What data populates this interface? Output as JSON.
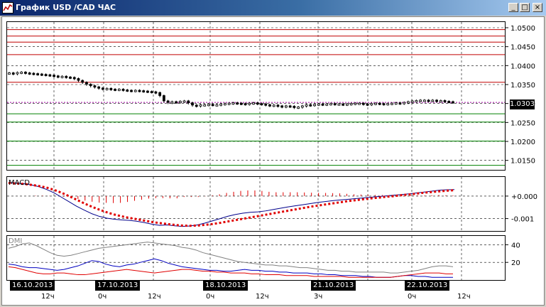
{
  "window": {
    "title": "График USD /CAD  ЧАС",
    "icon": "chart-window-icon",
    "controls": {
      "minimize": "_",
      "maximize": "□",
      "close": "×"
    }
  },
  "colors": {
    "titlebar": "#0a246a",
    "candle": "#000000",
    "resistance": "#c00000",
    "support": "#008000",
    "current_price_line": "#a000a0",
    "macd_line": "#00008b",
    "macd_signal": "#e00000",
    "dmi_adx": "#808080",
    "dmi_plus": "#0000c0",
    "dmi_minus": "#e00000"
  },
  "price_panel": {
    "ticks": [
      "1.0500",
      "1.0450",
      "1.0400",
      "1.0350",
      "1.0300",
      "1.0250",
      "1.0200",
      "1.0150"
    ],
    "current_price": "1.0303",
    "resistance_levels": [
      1.0495,
      1.0478,
      1.0462,
      1.0429,
      1.0356
    ],
    "support_levels": [
      1.0273,
      1.0251,
      1.0201,
      1.0137
    ]
  },
  "macd_panel": {
    "label": "MACD",
    "ticks": [
      "+0.000",
      "-0.001"
    ]
  },
  "dmi_panel": {
    "label": "DMI",
    "ticks": [
      "40",
      "20"
    ]
  },
  "time_axis": {
    "dates": [
      "16.10.2013",
      "17.10.2013",
      "18.10.2013",
      "21.10.2013",
      "22.10.2013"
    ],
    "hours": [
      "12ч",
      "0ч",
      "12ч",
      "0ч",
      "12ч",
      "3ч",
      "0ч",
      "12ч"
    ]
  },
  "chart_data": [
    {
      "type": "candlestick",
      "title": "График USD /CAD  ЧАС",
      "y_ticks": [
        1.05,
        1.045,
        1.04,
        1.035,
        1.03,
        1.025,
        1.02,
        1.015
      ],
      "ylim": [
        1.0125,
        1.0515
      ],
      "close": [
        1.038,
        1.0378,
        1.0381,
        1.0382,
        1.038,
        1.0379,
        1.0378,
        1.0377,
        1.0376,
        1.0375,
        1.0374,
        1.0372,
        1.037,
        1.0371,
        1.0369,
        1.0368,
        1.0365,
        1.036,
        1.0355,
        1.035,
        1.0346,
        1.0343,
        1.034,
        1.0338,
        1.0339,
        1.0337,
        1.0336,
        1.0337,
        1.0335,
        1.0334,
        1.0333,
        1.0334,
        1.0333,
        1.0332,
        1.0331,
        1.033,
        1.0328,
        1.032,
        1.0306,
        1.0302,
        1.0304,
        1.0303,
        1.0305,
        1.0306,
        1.0301,
        1.0295,
        1.0293,
        1.0296,
        1.0296,
        1.0297,
        1.0296,
        1.0296,
        1.0298,
        1.0299,
        1.03,
        1.0301,
        1.03,
        1.0299,
        1.0298,
        1.03,
        1.0301,
        1.0299,
        1.0298,
        1.0296,
        1.0294,
        1.0295,
        1.0293,
        1.0291,
        1.0293,
        1.0292,
        1.0289,
        1.029,
        1.0293,
        1.0296,
        1.0295,
        1.0297,
        1.0298,
        1.0297,
        1.0298,
        1.0299,
        1.0298,
        1.0298,
        1.0297,
        1.0298,
        1.0299,
        1.03,
        1.03,
        1.0298,
        1.0297,
        1.0299,
        1.03,
        1.0299,
        1.0298,
        1.0299,
        1.03,
        1.0301,
        1.03,
        1.0302,
        1.0304,
        1.0306,
        1.0307,
        1.0308,
        1.0308,
        1.0307,
        1.0308,
        1.0306,
        1.0307,
        1.0305,
        1.0304,
        1.0303
      ],
      "current": 1.0303
    },
    {
      "type": "line",
      "label": "MACD",
      "y_ticks": [
        "+0.000",
        "-0.001"
      ],
      "ylim": [
        -0.00155,
        0.00085
      ],
      "series": [
        {
          "values": [
            0.0006,
            0.00058,
            0.00055,
            0.0005,
            0.00042,
            0.0003,
            0.00015,
            -5e-05,
            -0.00025,
            -0.00045,
            -0.00062,
            -0.00078,
            -0.0009,
            -0.00098,
            -0.00103,
            -0.00106,
            -0.00108,
            -0.00112,
            -0.00118,
            -0.00125,
            -0.0013,
            -0.00128,
            -0.00132,
            -0.00135,
            -0.00133,
            -0.00128,
            -0.0012,
            -0.0011,
            -0.001,
            -0.0009,
            -0.00082,
            -0.00076,
            -0.00072,
            -0.0007,
            -0.00066,
            -0.0006,
            -0.00054,
            -0.00048,
            -0.00043,
            -0.00038,
            -0.00033,
            -0.00028,
            -0.00024,
            -0.0002,
            -0.00017,
            -0.00014,
            -0.00011,
            -8e-05,
            -5e-05,
            -2e-05,
            1e-05,
            4e-05,
            7e-05,
            0.0001,
            0.00014,
            0.00018,
            0.00022,
            0.00026,
            0.00028,
            0.00029
          ]
        },
        {
          "values": [
            0.00058,
            0.00056,
            0.00054,
            0.0005,
            0.00045,
            0.00038,
            0.00028,
            0.00015,
            0.0,
            -0.00016,
            -0.00032,
            -0.00047,
            -0.0006,
            -0.00072,
            -0.00082,
            -0.0009,
            -0.00097,
            -0.00103,
            -0.00109,
            -0.00115,
            -0.0012,
            -0.00124,
            -0.00128,
            -0.00131,
            -0.00132,
            -0.00131,
            -0.00128,
            -0.00124,
            -0.00119,
            -0.00113,
            -0.00107,
            -0.00101,
            -0.00095,
            -0.00089,
            -0.00083,
            -0.00077,
            -0.00071,
            -0.00065,
            -0.00059,
            -0.00053,
            -0.00047,
            -0.00042,
            -0.00037,
            -0.00032,
            -0.00027,
            -0.00022,
            -0.00018,
            -0.00014,
            -0.0001,
            -7e-05,
            -3e-05,
            0.0,
            4e-05,
            7e-05,
            0.00011,
            0.00015,
            0.00018,
            0.00021,
            0.00024,
            0.00026
          ]
        }
      ],
      "histogram": [
        2e-05,
        2e-05,
        1e-05,
        0.0,
        -3e-05,
        -8e-05,
        -0.00013,
        -0.0002,
        -0.00025,
        -0.00029,
        -0.0003,
        -0.00031,
        -0.0003,
        -0.00026,
        -0.00021,
        -0.00016,
        -0.00011,
        -9e-05,
        -9e-05,
        -0.0001,
        -0.0001,
        -4e-05,
        -4e-05,
        -4e-05,
        -1e-05,
        3e-05,
        8e-05,
        0.00014,
        0.00019,
        0.00023,
        0.00025,
        0.00025,
        0.00023,
        0.00019,
        0.00017,
        0.00017,
        0.00017,
        0.00017,
        0.00016,
        0.00015,
        0.00014,
        0.00014,
        0.00013,
        0.00012,
        0.0001,
        8e-05,
        7e-05,
        6e-05,
        5e-05,
        5e-05,
        4e-05,
        4e-05,
        3e-05,
        3e-05,
        3e-05,
        3e-05,
        4e-05,
        5e-05,
        4e-05,
        3e-05
      ]
    },
    {
      "type": "line",
      "label": "DMI",
      "y_ticks": [
        40,
        20
      ],
      "ylim": [
        0,
        50
      ],
      "series": [
        {
          "values": [
            36,
            38,
            41,
            42,
            39,
            35,
            31,
            28,
            27,
            28,
            30,
            32,
            34,
            36,
            37,
            38,
            39,
            40,
            41,
            42,
            43,
            42,
            41,
            40,
            39,
            37,
            36,
            34,
            31,
            29,
            27,
            25,
            23,
            21,
            20,
            19,
            18,
            17,
            17,
            16,
            16,
            15,
            14,
            14,
            13,
            12,
            11,
            11,
            10,
            10,
            9,
            9,
            9,
            9,
            9,
            8,
            8,
            9,
            10,
            11,
            13,
            15,
            16,
            16,
            15
          ]
        },
        {
          "values": [
            18,
            17,
            15,
            14,
            14,
            13,
            12,
            11,
            12,
            14,
            16,
            19,
            22,
            21,
            18,
            16,
            15,
            17,
            18,
            20,
            22,
            24,
            22,
            19,
            17,
            15,
            14,
            13,
            12,
            11,
            11,
            10,
            10,
            11,
            12,
            11,
            11,
            10,
            10,
            9,
            9,
            8,
            8,
            8,
            7,
            7,
            6,
            6,
            5,
            5,
            5,
            4,
            4,
            3,
            3,
            3,
            4,
            5,
            5,
            4,
            4,
            3,
            3,
            3,
            3
          ]
        },
        {
          "values": [
            15,
            14,
            12,
            10,
            8,
            7,
            7,
            8,
            8,
            7,
            6,
            6,
            7,
            8,
            9,
            10,
            11,
            12,
            11,
            10,
            9,
            8,
            9,
            10,
            11,
            12,
            12,
            11,
            10,
            10,
            9,
            9,
            8,
            8,
            8,
            7,
            7,
            6,
            6,
            6,
            5,
            5,
            5,
            5,
            4,
            4,
            4,
            4,
            4,
            3,
            3,
            3,
            3,
            3,
            3,
            3,
            4,
            5,
            6,
            7,
            8,
            8,
            8,
            7,
            7
          ]
        }
      ]
    }
  ]
}
